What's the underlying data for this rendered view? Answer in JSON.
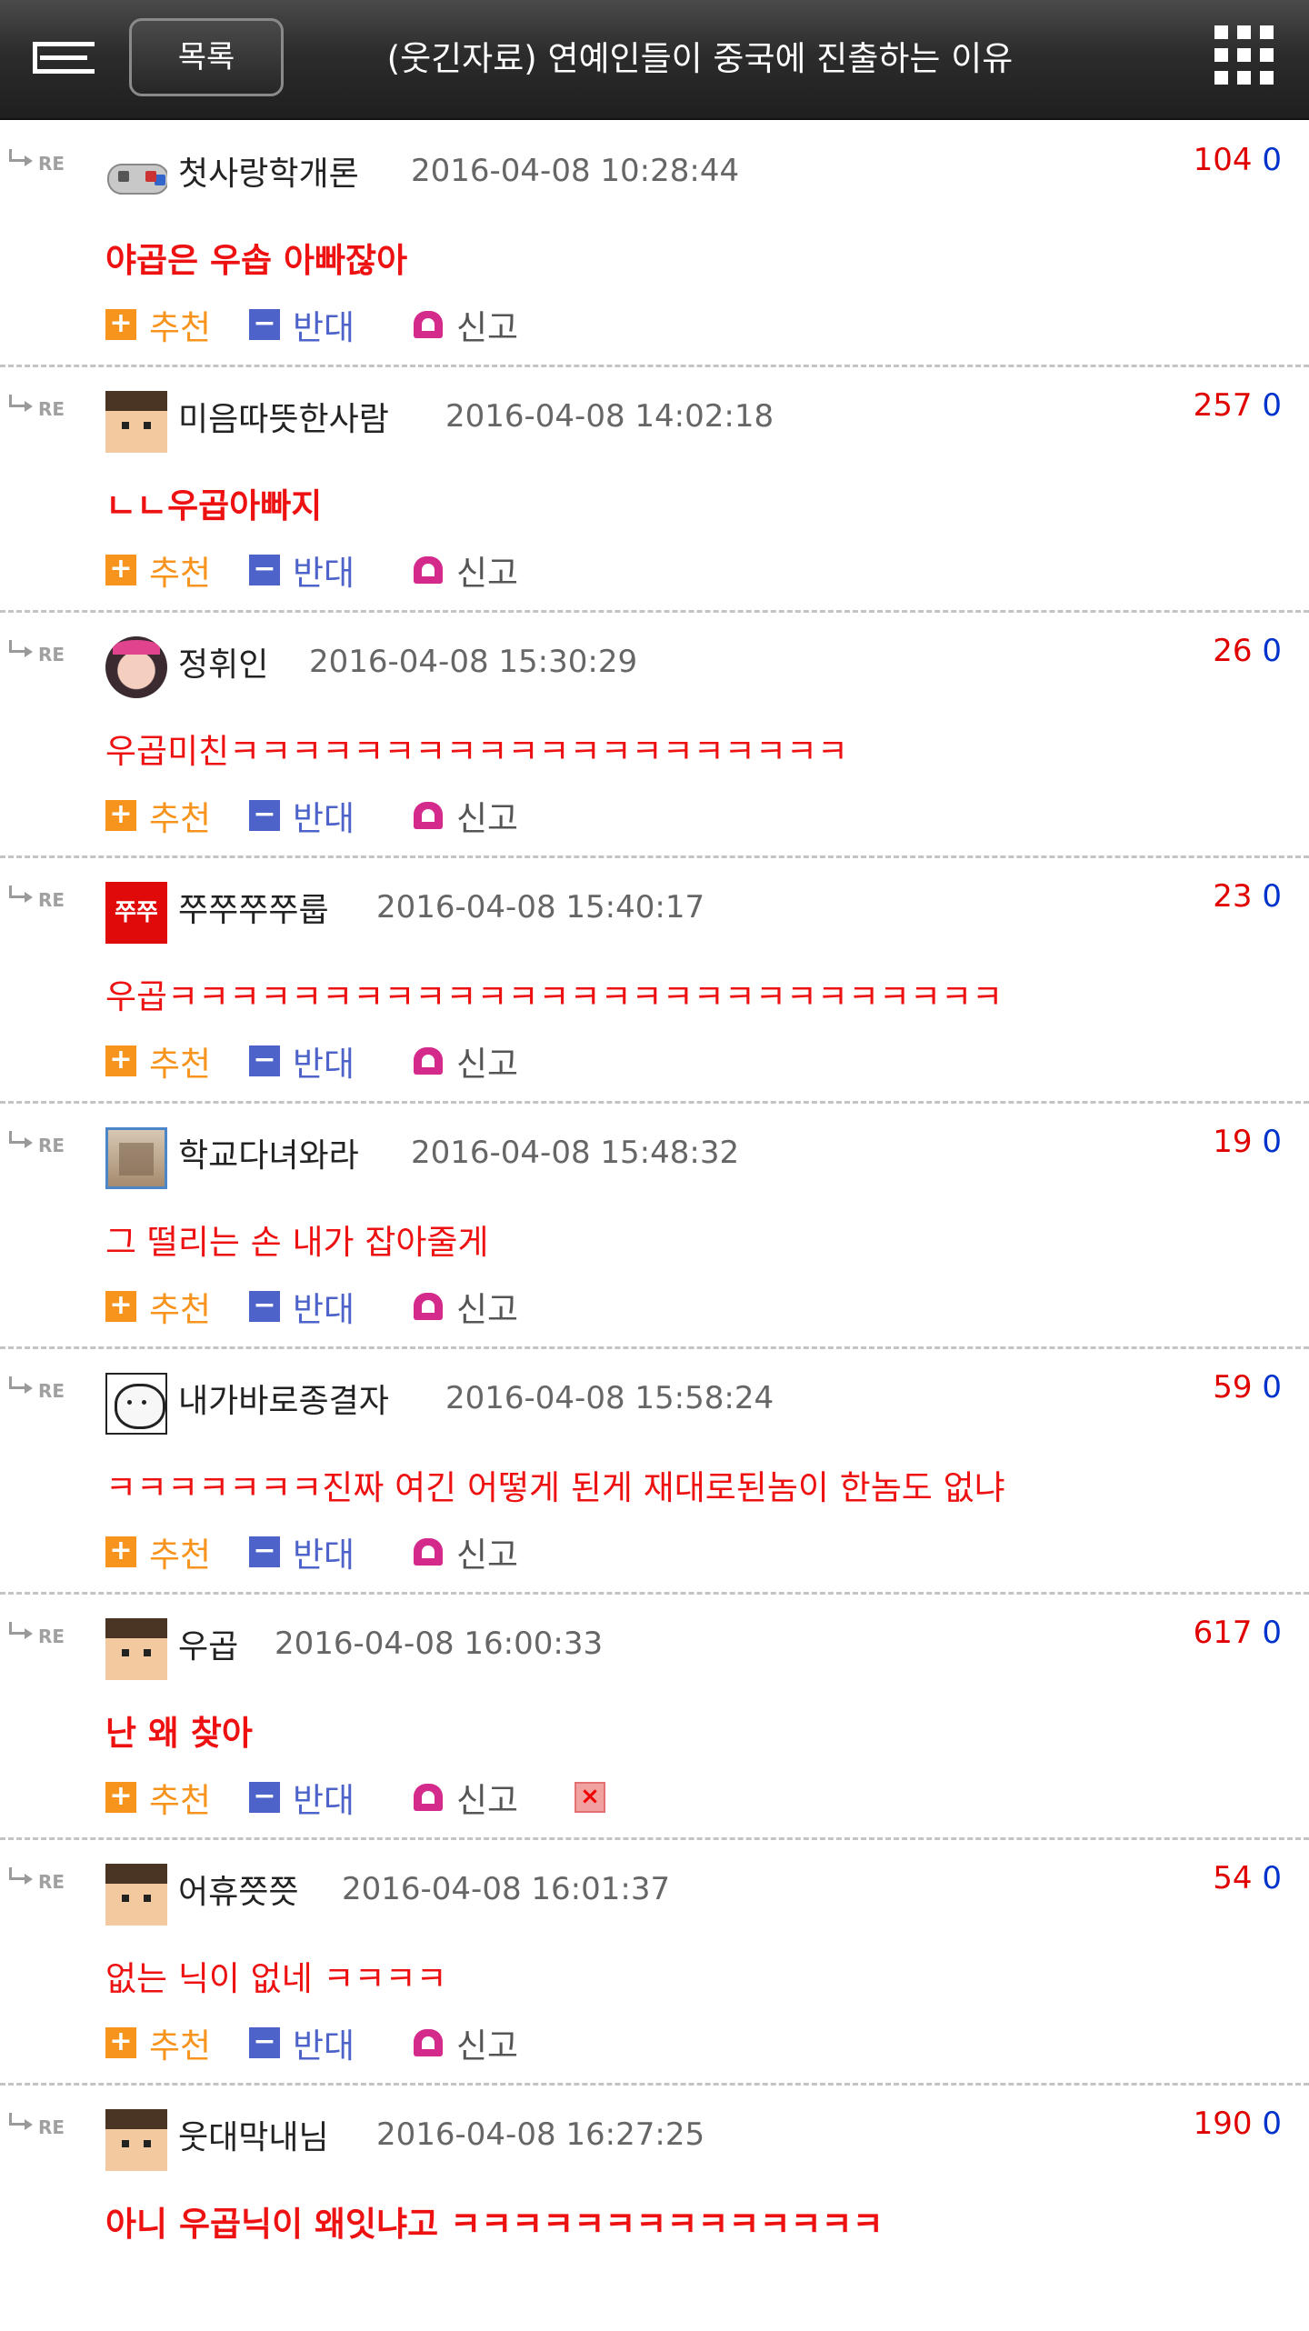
{
  "header": {
    "list_label": "목록",
    "title": "(웃긴자료) 연예인들이 중국에 진출하는 이유"
  },
  "re_label": "RE",
  "actions": {
    "recommend_label": "추천",
    "oppose_label": "반대",
    "report_label": "신고",
    "recommend_icon": "+",
    "oppose_icon": "−",
    "delete_icon": "×"
  },
  "comments": [
    {
      "nick": "첫사랑학개론",
      "date": "2016-04-08 10:28:44",
      "up": "104",
      "down": "0",
      "text": "야곱은 우솝 아빠잖아"
    },
    {
      "nick": "미음따뜻한사람",
      "date": "2016-04-08 14:02:18",
      "up": "257",
      "down": "0",
      "text": "ㄴㄴ우곱아빠지"
    },
    {
      "nick": "정휘인",
      "date": "2016-04-08 15:30:29",
      "up": "26",
      "down": "0",
      "text": "우곱미친ㅋㅋㅋㅋㅋㅋㅋㅋㅋㅋㅋㅋㅋㅋㅋㅋㅋㅋㅋㅋ"
    },
    {
      "nick": "쭈쭈쭈쭈룹",
      "date": "2016-04-08 15:40:17",
      "up": "23",
      "down": "0",
      "text": "우곱ㅋㅋㅋㅋㅋㅋㅋㅋㅋㅋㅋㅋㅋㅋㅋㅋㅋㅋㅋㅋㅋㅋㅋㅋㅋㅋㅋ",
      "avatar_text": "쭈쭈"
    },
    {
      "nick": "학교다녀와라",
      "date": "2016-04-08 15:48:32",
      "up": "19",
      "down": "0",
      "text": "그 떨리는 손 내가 잡아줄게"
    },
    {
      "nick": "내가바로종결자",
      "date": "2016-04-08 15:58:24",
      "up": "59",
      "down": "0",
      "text": "ㅋㅋㅋㅋㅋㅋㅋ진짜 여긴 어떻게 된게 재대로된놈이 한놈도 없냐"
    },
    {
      "nick": "우곱",
      "date": "2016-04-08 16:00:33",
      "up": "617",
      "down": "0",
      "text": "난 왜 찾아"
    },
    {
      "nick": "어휴쯧쯧",
      "date": "2016-04-08 16:01:37",
      "up": "54",
      "down": "0",
      "text": "없는 닉이 없네 ㅋㅋㅋㅋ"
    },
    {
      "nick": "웃대막내님",
      "date": "2016-04-08 16:27:25",
      "up": "190",
      "down": "0",
      "text": "아니 우곱닉이 왜잇냐고 ㅋㅋㅋㅋㅋㅋㅋㅋㅋㅋㅋㅋㅋㅋ"
    }
  ]
}
